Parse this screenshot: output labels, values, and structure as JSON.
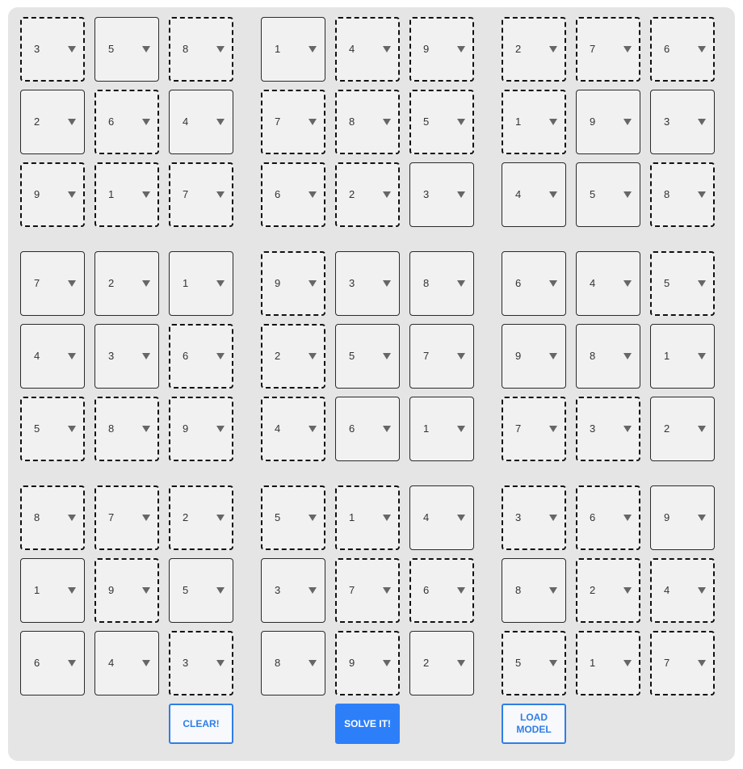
{
  "grid": [
    [
      {
        "v": "3",
        "d": true
      },
      {
        "v": "5",
        "d": false
      },
      {
        "v": "8",
        "d": true
      },
      {
        "v": "1",
        "d": false
      },
      {
        "v": "4",
        "d": true
      },
      {
        "v": "9",
        "d": true
      },
      {
        "v": "2",
        "d": true
      },
      {
        "v": "7",
        "d": true
      },
      {
        "v": "6",
        "d": true
      }
    ],
    [
      {
        "v": "2",
        "d": false
      },
      {
        "v": "6",
        "d": true
      },
      {
        "v": "4",
        "d": false
      },
      {
        "v": "7",
        "d": true
      },
      {
        "v": "8",
        "d": true
      },
      {
        "v": "5",
        "d": true
      },
      {
        "v": "1",
        "d": true
      },
      {
        "v": "9",
        "d": false
      },
      {
        "v": "3",
        "d": false
      }
    ],
    [
      {
        "v": "9",
        "d": true
      },
      {
        "v": "1",
        "d": true
      },
      {
        "v": "7",
        "d": true
      },
      {
        "v": "6",
        "d": true
      },
      {
        "v": "2",
        "d": true
      },
      {
        "v": "3",
        "d": false
      },
      {
        "v": "4",
        "d": false
      },
      {
        "v": "5",
        "d": false
      },
      {
        "v": "8",
        "d": true
      }
    ],
    [
      {
        "v": "7",
        "d": false
      },
      {
        "v": "2",
        "d": false
      },
      {
        "v": "1",
        "d": false
      },
      {
        "v": "9",
        "d": true
      },
      {
        "v": "3",
        "d": false
      },
      {
        "v": "8",
        "d": false
      },
      {
        "v": "6",
        "d": false
      },
      {
        "v": "4",
        "d": false
      },
      {
        "v": "5",
        "d": true
      }
    ],
    [
      {
        "v": "4",
        "d": false
      },
      {
        "v": "3",
        "d": false
      },
      {
        "v": "6",
        "d": true
      },
      {
        "v": "2",
        "d": true
      },
      {
        "v": "5",
        "d": false
      },
      {
        "v": "7",
        "d": false
      },
      {
        "v": "9",
        "d": false
      },
      {
        "v": "8",
        "d": false
      },
      {
        "v": "1",
        "d": false
      }
    ],
    [
      {
        "v": "5",
        "d": true
      },
      {
        "v": "8",
        "d": true
      },
      {
        "v": "9",
        "d": true
      },
      {
        "v": "4",
        "d": true
      },
      {
        "v": "6",
        "d": false
      },
      {
        "v": "1",
        "d": false
      },
      {
        "v": "7",
        "d": true
      },
      {
        "v": "3",
        "d": true
      },
      {
        "v": "2",
        "d": false
      }
    ],
    [
      {
        "v": "8",
        "d": true
      },
      {
        "v": "7",
        "d": true
      },
      {
        "v": "2",
        "d": true
      },
      {
        "v": "5",
        "d": true
      },
      {
        "v": "1",
        "d": true
      },
      {
        "v": "4",
        "d": false
      },
      {
        "v": "3",
        "d": true
      },
      {
        "v": "6",
        "d": true
      },
      {
        "v": "9",
        "d": false
      }
    ],
    [
      {
        "v": "1",
        "d": false
      },
      {
        "v": "9",
        "d": true
      },
      {
        "v": "5",
        "d": false
      },
      {
        "v": "3",
        "d": false
      },
      {
        "v": "7",
        "d": true
      },
      {
        "v": "6",
        "d": true
      },
      {
        "v": "8",
        "d": false
      },
      {
        "v": "2",
        "d": true
      },
      {
        "v": "4",
        "d": true
      }
    ],
    [
      {
        "v": "6",
        "d": false
      },
      {
        "v": "4",
        "d": false
      },
      {
        "v": "3",
        "d": true
      },
      {
        "v": "8",
        "d": false
      },
      {
        "v": "9",
        "d": true
      },
      {
        "v": "2",
        "d": false
      },
      {
        "v": "5",
        "d": true
      },
      {
        "v": "1",
        "d": true
      },
      {
        "v": "7",
        "d": true
      }
    ]
  ],
  "buttons": {
    "clear_label": "CLEAR!",
    "solve_label": "SOLVE IT!",
    "load_label": "LOAD MODEL"
  },
  "icons": {
    "dropdown": "chevron-down-icon"
  },
  "colors": {
    "accent": "#2d7ff9",
    "panel": "#e5e5e5",
    "cell": "#f1f1f1"
  }
}
